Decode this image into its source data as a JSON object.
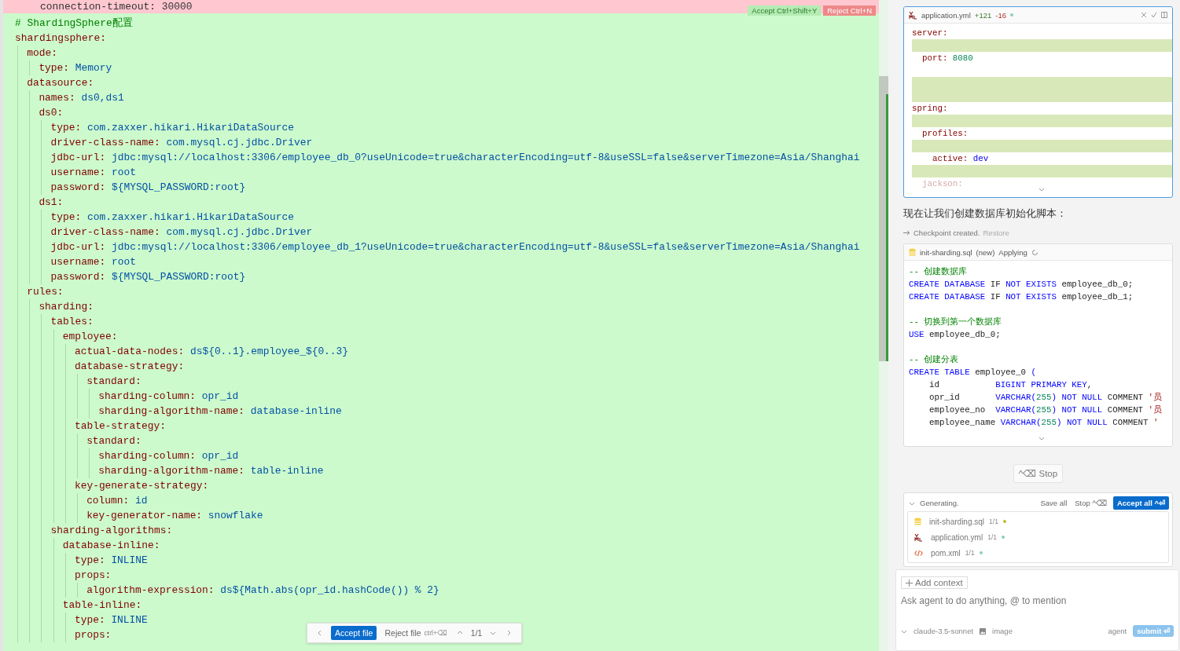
{
  "editor": {
    "deleted_line": "connection-timeout: 30000",
    "hunk_accept": "Accept Ctrl+Shift+Y",
    "hunk_reject": "Reject Ctrl+N",
    "comment": "# ShardingSphere配置",
    "lines": [
      {
        "key": "shardingsphere:",
        "children": [
          {
            "key": "mode:",
            "children": [
              {
                "key": "type:",
                "value": "Memory"
              }
            ]
          },
          {
            "key": "datasource:",
            "children": [
              {
                "key": "names:",
                "value": "ds0,ds1"
              },
              {
                "key": "ds0:",
                "children": [
                  {
                    "key": "type:",
                    "value": "com.zaxxer.hikari.HikariDataSource"
                  },
                  {
                    "key": "driver-class-name:",
                    "value": "com.mysql.cj.jdbc.Driver"
                  },
                  {
                    "key": "jdbc-url:",
                    "value": "jdbc:mysql://localhost:3306/employee_db_0?useUnicode=true&characterEncoding=utf-8&useSSL=false&serverTimezone=Asia/Shanghai"
                  },
                  {
                    "key": "username:",
                    "value": "root"
                  },
                  {
                    "key": "password:",
                    "value": "${MYSQL_PASSWORD:root}"
                  }
                ]
              },
              {
                "key": "ds1:",
                "children": [
                  {
                    "key": "type:",
                    "value": "com.zaxxer.hikari.HikariDataSource"
                  },
                  {
                    "key": "driver-class-name:",
                    "value": "com.mysql.cj.jdbc.Driver"
                  },
                  {
                    "key": "jdbc-url:",
                    "value": "jdbc:mysql://localhost:3306/employee_db_1?useUnicode=true&characterEncoding=utf-8&useSSL=false&serverTimezone=Asia/Shanghai"
                  },
                  {
                    "key": "username:",
                    "value": "root"
                  },
                  {
                    "key": "password:",
                    "value": "${MYSQL_PASSWORD:root}"
                  }
                ]
              }
            ]
          },
          {
            "key": "rules:",
            "children": [
              {
                "key": "sharding:",
                "children": [
                  {
                    "key": "tables:",
                    "children": [
                      {
                        "key": "employee:",
                        "children": [
                          {
                            "key": "actual-data-nodes:",
                            "value": "ds${0..1}.employee_${0..3}"
                          },
                          {
                            "key": "database-strategy:",
                            "children": [
                              {
                                "key": "standard:",
                                "children": [
                                  {
                                    "key": "sharding-column:",
                                    "value": "opr_id"
                                  },
                                  {
                                    "key": "sharding-algorithm-name:",
                                    "value": "database-inline"
                                  }
                                ]
                              }
                            ]
                          },
                          {
                            "key": "table-strategy:",
                            "children": [
                              {
                                "key": "standard:",
                                "children": [
                                  {
                                    "key": "sharding-column:",
                                    "value": "opr_id"
                                  },
                                  {
                                    "key": "sharding-algorithm-name:",
                                    "value": "table-inline"
                                  }
                                ]
                              }
                            ]
                          },
                          {
                            "key": "key-generate-strategy:",
                            "children": [
                              {
                                "key": "column:",
                                "value": "id"
                              },
                              {
                                "key": "key-generator-name:",
                                "value": "snowflake"
                              }
                            ]
                          }
                        ]
                      }
                    ]
                  },
                  {
                    "key": "sharding-algorithms:",
                    "children": [
                      {
                        "key": "database-inline:",
                        "children": [
                          {
                            "key": "type:",
                            "value": "INLINE"
                          },
                          {
                            "key": "props:",
                            "children": [
                              {
                                "key": "algorithm-expression:",
                                "value": "ds${Math.abs(opr_id.hashCode()) % 2}"
                              }
                            ]
                          }
                        ]
                      },
                      {
                        "key": "table-inline:",
                        "children": [
                          {
                            "key": "type:",
                            "value": "INLINE"
                          },
                          {
                            "key": "props:"
                          }
                        ]
                      }
                    ]
                  }
                ]
              }
            ]
          }
        ]
      }
    ],
    "review_bar": {
      "accept": "Accept file",
      "reject": "Reject file",
      "reject_shortcut": "ctrl+⌫",
      "count": "1/1"
    }
  },
  "yml_card": {
    "file": "application.yml",
    "added": "+121",
    "removed": "-16",
    "rows": [
      {
        "key": "server:",
        "added": false
      },
      {
        "added": true
      },
      {
        "key": "  port:",
        "value": "8080",
        "kind": "number",
        "added": false
      },
      {
        "kind": "blank"
      },
      {
        "added": true
      },
      {
        "added": true
      },
      {
        "key": "spring:",
        "added": false
      },
      {
        "added": true
      },
      {
        "key": "  profiles:",
        "added": false
      },
      {
        "added": true
      },
      {
        "key": "    active:",
        "value": "dev",
        "kind": "word",
        "added": false
      },
      {
        "added": true
      },
      {
        "key": "  jackson:",
        "added": false,
        "faded": true
      }
    ]
  },
  "message": "现在让我们创建数据库初始化脚本：",
  "checkpoint": {
    "text": "Checkpoint created.",
    "link": "Restore"
  },
  "sql_card": {
    "file": "init-sharding.sql",
    "tag": "(new)",
    "status": "Applying",
    "blocks": [
      [
        [
          {
            "kind": "comment",
            "t": "-- 创建数据库"
          }
        ],
        [
          {
            "kind": "kw",
            "t": "CREATE DATABASE"
          },
          {
            "kind": "plain",
            "t": " IF "
          },
          {
            "kind": "kw",
            "t": "NOT EXISTS"
          },
          {
            "kind": "plain",
            "t": " employee_db_0;"
          }
        ],
        [
          {
            "kind": "kw",
            "t": "CREATE DATABASE"
          },
          {
            "kind": "plain",
            "t": " IF "
          },
          {
            "kind": "kw",
            "t": "NOT EXISTS"
          },
          {
            "kind": "plain",
            "t": " employee_db_1;"
          }
        ]
      ],
      [
        [
          {
            "kind": "comment",
            "t": "-- 切换到第一个数据库"
          }
        ],
        [
          {
            "kind": "kw",
            "t": "USE"
          },
          {
            "kind": "plain",
            "t": " employee_db_0;"
          }
        ]
      ],
      [
        [
          {
            "kind": "comment",
            "t": "-- 创建分表"
          }
        ],
        [
          {
            "kind": "kw",
            "t": "CREATE TABLE"
          },
          {
            "kind": "plain",
            "t": " employee_0 "
          },
          {
            "kind": "kw",
            "t": "("
          }
        ],
        [
          {
            "kind": "plain",
            "t": "    id           "
          },
          {
            "kind": "kw",
            "t": "BIGINT PRIMARY KEY"
          },
          {
            "kind": "plain",
            "t": ","
          }
        ],
        [
          {
            "kind": "plain",
            "t": "    opr_id       "
          },
          {
            "kind": "kw",
            "t": "VARCHAR("
          },
          {
            "kind": "num",
            "t": "255"
          },
          {
            "kind": "kw",
            "t": ") NOT NULL"
          },
          {
            "kind": "plain",
            "t": " COMMENT "
          },
          {
            "kind": "str",
            "t": "'员"
          }
        ],
        [
          {
            "kind": "plain",
            "t": "    employee_no  "
          },
          {
            "kind": "kw",
            "t": "VARCHAR("
          },
          {
            "kind": "num",
            "t": "255"
          },
          {
            "kind": "kw",
            "t": ") NOT NULL"
          },
          {
            "kind": "plain",
            "t": " COMMENT "
          },
          {
            "kind": "str",
            "t": "'员"
          }
        ],
        [
          {
            "kind": "plain",
            "t": "    employee_name "
          },
          {
            "kind": "kw",
            "t": "VARCHAR("
          },
          {
            "kind": "num",
            "t": "255"
          },
          {
            "kind": "kw",
            "t": ") NOT NULL"
          },
          {
            "kind": "plain",
            "t": " COMMENT "
          },
          {
            "kind": "str",
            "t": "'"
          }
        ]
      ]
    ]
  },
  "stop_button": {
    "keys": "^⌫",
    "label": "Stop"
  },
  "generating": {
    "status": "Generating.",
    "save_all": "Save all",
    "stop": "Stop ^⌫",
    "accept_all": "Accept all ^⏎",
    "files": [
      {
        "name": "init-sharding.sql",
        "count": "1/1",
        "kind": "sql",
        "color": "#c8b830"
      },
      {
        "name": "application.yml",
        "count": "1/1",
        "kind": "yaml",
        "color": "#8ccfb0"
      },
      {
        "name": "pom.xml",
        "count": "1/1",
        "kind": "xml",
        "color": "#8ccfb0"
      }
    ]
  },
  "composer": {
    "add_context": "Add context",
    "placeholder": "Ask agent to do anything, @ to mention",
    "model": "claude-3.5-sonnet",
    "image": "image",
    "mode": "agent",
    "submit": "submit ⏎"
  }
}
